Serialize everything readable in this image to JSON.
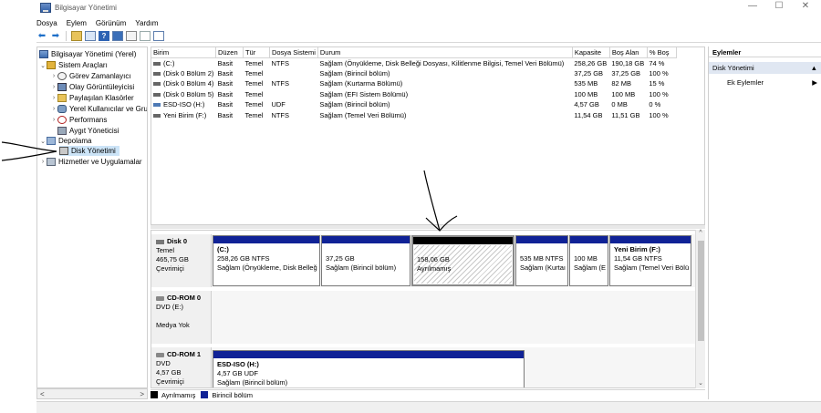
{
  "window": {
    "title": "Bilgisayar Yönetimi",
    "minimize_glyph": "—",
    "maximize_glyph": "☐",
    "close_glyph": "✕"
  },
  "menu": [
    "Dosya",
    "Eylem",
    "Görünüm",
    "Yardım"
  ],
  "toolbar": {
    "icons": [
      "back-arrow-icon",
      "forward-arrow-icon",
      "up-folder-icon",
      "show-hide-tree-icon",
      "help-icon",
      "properties-icon",
      "connect-icon",
      "checklist-icon",
      "view-icon"
    ],
    "back_glyph": "⬅",
    "forward_glyph": "➡",
    "help_glyph": "?"
  },
  "tree": {
    "root": "Bilgisayar Yönetimi (Yerel)",
    "system_tools": "Sistem Araçları",
    "task_scheduler": "Görev Zamanlayıcı",
    "event_viewer": "Olay Görüntüleyicisi",
    "shared_folders": "Paylaşılan Klasörler",
    "local_users": "Yerel Kullanıcılar ve Gru",
    "performance": "Performans",
    "device_manager": "Aygıt Yöneticisi",
    "storage": "Depolama",
    "disk_management": "Disk Yönetimi",
    "services": "Hizmetler ve Uygulamalar",
    "expand_open": "⌄",
    "expand_closed": "›",
    "scroll_left": "<",
    "scroll_right": ">"
  },
  "volumes": {
    "columns": [
      "Birim",
      "Düzen",
      "Tür",
      "Dosya Sistemi",
      "Durum",
      "Kapasite",
      "Boş Alan",
      "% Boş"
    ],
    "rows": [
      [
        "(C:)",
        "Basit",
        "Temel",
        "NTFS",
        "Sağlam (Önyükleme, Disk Belleği Dosyası, Kilitlenme Bilgisi, Temel Veri Bölümü)",
        "258,26 GB",
        "190,18 GB",
        "74 %"
      ],
      [
        "(Disk 0 Bölüm 2)",
        "Basit",
        "Temel",
        "",
        "Sağlam (Birincil bölüm)",
        "37,25 GB",
        "37,25 GB",
        "100 %"
      ],
      [
        "(Disk 0 Bölüm 4)",
        "Basit",
        "Temel",
        "NTFS",
        "Sağlam (Kurtarma Bölümü)",
        "535 MB",
        "82 MB",
        "15 %"
      ],
      [
        "(Disk 0 Bölüm 5)",
        "Basit",
        "Temel",
        "",
        "Sağlam (EFI Sistem Bölümü)",
        "100 MB",
        "100 MB",
        "100 %"
      ],
      [
        "ESD-ISO (H:)",
        "Basit",
        "Temel",
        "UDF",
        "Sağlam (Birincil bölüm)",
        "4,57 GB",
        "0 MB",
        "0 %"
      ],
      [
        "Yeni Birim (F:)",
        "Basit",
        "Temel",
        "NTFS",
        "Sağlam (Temel Veri Bölümü)",
        "11,54 GB",
        "11,51 GB",
        "100 %"
      ]
    ]
  },
  "disks": {
    "disk0": {
      "name": "Disk 0",
      "type": "Temel",
      "size": "465,75 GB",
      "status": "Çevrimiçi",
      "partitions": [
        {
          "label": "(C:)",
          "size": "258,26 GB NTFS",
          "status": "Sağlam (Önyükleme, Disk Belleğ"
        },
        {
          "label": "",
          "size": "37,25 GB",
          "status": "Sağlam (Birincil bölüm)"
        },
        {
          "label": "",
          "size": "158,06 GB",
          "status": "Ayrılmamış"
        },
        {
          "label": "",
          "size": "535 MB NTFS",
          "status": "Sağlam (Kurtaı"
        },
        {
          "label": "",
          "size": "100 MB",
          "status": "Sağlam (E"
        },
        {
          "label": "Yeni Birim  (F:)",
          "size": "11,54 GB NTFS",
          "status": "Sağlam (Temel Veri Bölü"
        }
      ]
    },
    "cdrom0": {
      "name": "CD-ROM 0",
      "type": "DVD (E:)",
      "status": "Medya Yok"
    },
    "cdrom1": {
      "name": "CD-ROM 1",
      "type": "DVD",
      "size": "4,57 GB",
      "status": "Çevrimiçi",
      "partition": {
        "label": "ESD-ISO  (H:)",
        "size": "4,57 GB UDF",
        "status": "Sağlam (Birincil bölüm)"
      }
    }
  },
  "legend": {
    "unallocated": "Ayrılmamış",
    "primary": "Birincil bölüm",
    "unallocated_color": "#000000",
    "primary_color": "#102296"
  },
  "actions": {
    "header": "Eylemler",
    "group": "Disk Yönetimi",
    "group_glyph": "▲",
    "more": "Ek Eylemler",
    "more_glyph": "▶"
  },
  "scroll": {
    "up": "^",
    "down": "⌄"
  }
}
